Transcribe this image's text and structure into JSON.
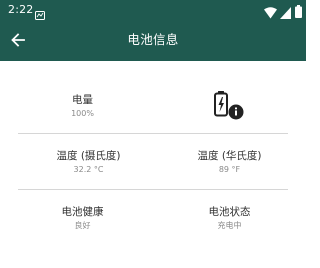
{
  "status_bar": {
    "time": "2:22",
    "icons": [
      "notification-icon",
      "wifi-icon",
      "signal-icon",
      "battery-status-icon"
    ]
  },
  "toolbar": {
    "title": "电池信息",
    "back_icon": "arrow-back-icon"
  },
  "info": {
    "level": {
      "label": "电量",
      "value": "100%"
    },
    "charging_icon": "battery-charging-info-icon",
    "temp_c": {
      "label": "温度 (摄氏度)",
      "value": "32.2 °C"
    },
    "temp_f": {
      "label": "温度 (华氏度)",
      "value": "89 °F"
    },
    "health": {
      "label": "电池健康",
      "value": "良好"
    },
    "status": {
      "label": "电池状态",
      "value": "充电中"
    }
  },
  "colors": {
    "toolbar": "#1f5a50",
    "background": "#ffffff",
    "divider": "#d6d6d6",
    "label": "#333333",
    "value": "#8a8a8a"
  }
}
